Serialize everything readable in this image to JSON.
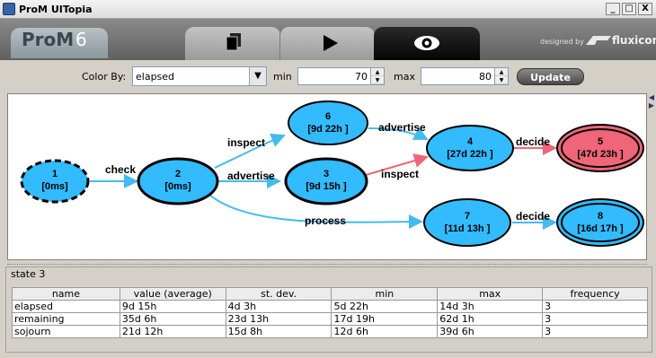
{
  "window": {
    "title": "ProM UITopia",
    "minimize": "_",
    "maximize": "□",
    "close": "X"
  },
  "header": {
    "logo_text": "ProM",
    "logo_version": "6",
    "designed_by": "designed by",
    "brand": "fluxicon"
  },
  "controls": {
    "color_by_label": "Color By:",
    "color_by_value": "elapsed",
    "min_label": "min",
    "min_value": "70",
    "max_label": "max",
    "max_value": "80",
    "update_label": "Update"
  },
  "graph": {
    "nodes": [
      {
        "id": "1",
        "time": "[0ms]"
      },
      {
        "id": "2",
        "time": "[0ms]"
      },
      {
        "id": "6",
        "time": "[9d 22h ]"
      },
      {
        "id": "3",
        "time": "[9d 15h ]"
      },
      {
        "id": "4",
        "time": "[27d 22h ]"
      },
      {
        "id": "5",
        "time": "[47d 23h ]"
      },
      {
        "id": "7",
        "time": "[11d 13h ]"
      },
      {
        "id": "8",
        "time": "[16d 17h ]"
      }
    ],
    "edge_labels": {
      "check": "check",
      "inspect_2_6": "inspect",
      "advertise_2_3": "advertise",
      "process": "process",
      "advertise_6_4": "advertise",
      "inspect_3_4": "inspect",
      "decide_4_5": "decide",
      "decide_7_8": "decide"
    },
    "colors": {
      "node_blue": "#33bbff",
      "node_red": "#ee6677",
      "edge_blue": "#44bbee",
      "edge_red": "#ee6677"
    }
  },
  "state": {
    "title": "state 3",
    "columns": [
      "name",
      "value (average)",
      "st. dev.",
      "min",
      "max",
      "frequency"
    ],
    "rows": [
      [
        "elapsed",
        "9d 15h",
        "4d 3h",
        "5d 22h",
        "14d 3h",
        "3"
      ],
      [
        "remaining",
        "35d 6h",
        "23d 13h",
        "17d 19h",
        "62d 1h",
        "3"
      ],
      [
        "sojourn",
        "21d 12h",
        "15d 8h",
        "12d 6h",
        "39d 6h",
        "3"
      ]
    ]
  }
}
